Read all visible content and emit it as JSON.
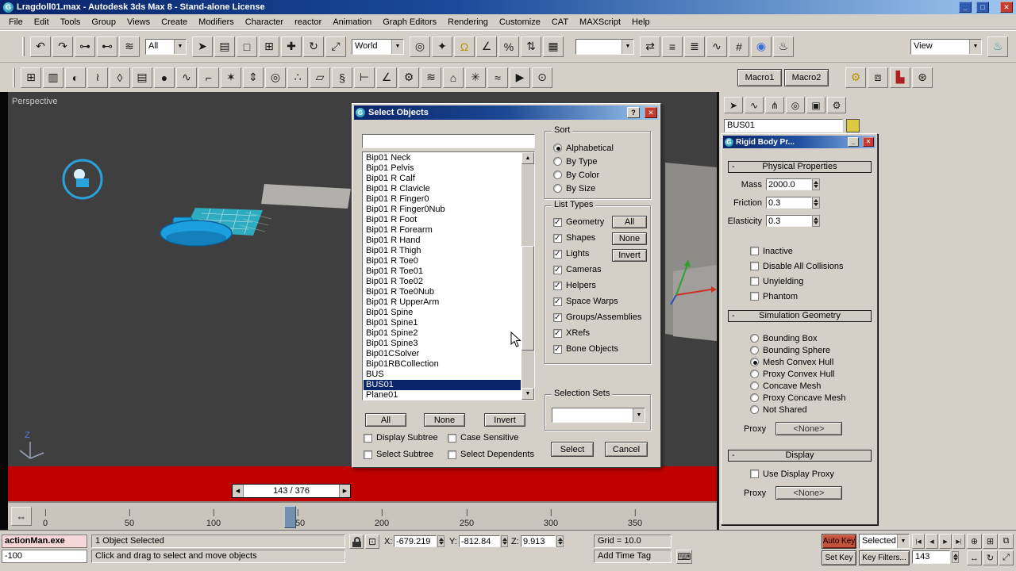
{
  "window": {
    "title": "Lragdoll01.max - Autodesk 3ds Max 8 - Stand-alone License",
    "icon_letter": "G",
    "min_glyph": "_",
    "max_glyph": "□",
    "close_glyph": "✕"
  },
  "menu": {
    "items": [
      "File",
      "Edit",
      "Tools",
      "Group",
      "Views",
      "Create",
      "Modifiers",
      "Character",
      "reactor",
      "Animation",
      "Graph Editors",
      "Rendering",
      "Customize",
      "CAT",
      "MAXScript",
      "Help"
    ]
  },
  "toolbar1": {
    "filter_dropdown": "All",
    "coord_dropdown": "World",
    "render_type_dropdown": "View",
    "group1": [
      {
        "name": "undo-icon",
        "glyph": "↶"
      },
      {
        "name": "redo-icon",
        "glyph": "↷"
      },
      {
        "name": "select-and-link-icon",
        "glyph": "⊶"
      },
      {
        "name": "unlink-selection-icon",
        "glyph": "⊷"
      },
      {
        "name": "bind-to-space-warp-icon",
        "glyph": "≋"
      }
    ],
    "group2": [
      {
        "name": "select-object-icon",
        "glyph": "➤"
      },
      {
        "name": "select-by-name-icon",
        "glyph": "▤"
      },
      {
        "name": "rectangular-selection-icon",
        "glyph": "□"
      },
      {
        "name": "window-crossing-icon",
        "glyph": "⊞"
      },
      {
        "name": "select-and-move-icon",
        "glyph": "✚"
      },
      {
        "name": "select-and-rotate-icon",
        "glyph": "↻"
      },
      {
        "name": "select-and-scale-icon",
        "glyph": "⤢"
      }
    ],
    "group3": [
      {
        "name": "use-pivot-center-icon",
        "glyph": "◎"
      },
      {
        "name": "select-and-manipulate-icon",
        "glyph": "✦"
      },
      {
        "name": "snap-toggle-icon",
        "glyph": "Ω",
        "cls": "yellow"
      },
      {
        "name": "angle-snap-icon",
        "glyph": "∠"
      },
      {
        "name": "percent-snap-icon",
        "glyph": "%"
      },
      {
        "name": "spinner-snap-icon",
        "glyph": "⇅"
      },
      {
        "name": "named-selection-sets-icon",
        "glyph": "▦"
      }
    ],
    "group4": [
      {
        "name": "mirror-icon",
        "glyph": "⇄"
      },
      {
        "name": "align-icon",
        "glyph": "≡"
      },
      {
        "name": "layer-manager-icon",
        "glyph": "≣"
      },
      {
        "name": "curve-editor-icon",
        "glyph": "∿"
      },
      {
        "name": "schematic-view-icon",
        "glyph": "#"
      },
      {
        "name": "material-editor-icon",
        "glyph": "◉",
        "cls": "mat"
      },
      {
        "name": "render-scene-icon",
        "glyph": "♨"
      }
    ],
    "group5": [
      {
        "name": "quick-render-icon",
        "glyph": "♨",
        "cls": "teal"
      }
    ]
  },
  "toolbar2": {
    "icons": [
      {
        "name": "rigid-body-collection-icon",
        "glyph": "⊞"
      },
      {
        "name": "cloth-collection-icon",
        "glyph": "▥"
      },
      {
        "name": "soft-body-collection-icon",
        "glyph": "◐"
      },
      {
        "name": "rope-collection-icon",
        "glyph": "≀"
      },
      {
        "name": "deforming-mesh-collection-icon",
        "glyph": "◊"
      },
      {
        "name": "cloth-modifier-icon",
        "glyph": "▤"
      },
      {
        "name": "soft-body-modifier-icon",
        "glyph": "●"
      },
      {
        "name": "rope-modifier-icon",
        "glyph": "∿"
      },
      {
        "name": "hinge-constraint-icon",
        "glyph": "⌐"
      },
      {
        "name": "ragdoll-constraint-icon",
        "glyph": "✶"
      },
      {
        "name": "prismatic-constraint-icon",
        "glyph": "⇕"
      },
      {
        "name": "car-wheel-constraint-icon",
        "glyph": "◎"
      },
      {
        "name": "point-point-constraint-icon",
        "glyph": "∴"
      },
      {
        "name": "plane-primitive-icon",
        "glyph": "▱"
      },
      {
        "name": "spring-icon",
        "glyph": "§"
      },
      {
        "name": "linear-dashpot-icon",
        "glyph": "⊢"
      },
      {
        "name": "angular-dashpot-icon",
        "glyph": "∠"
      },
      {
        "name": "motor-icon",
        "glyph": "⚙"
      },
      {
        "name": "wind-icon",
        "glyph": "≋"
      },
      {
        "name": "toy-car-icon",
        "glyph": "⌂"
      },
      {
        "name": "fracture-icon",
        "glyph": "✳"
      },
      {
        "name": "water-icon",
        "glyph": "≈"
      },
      {
        "name": "preview-animation-icon",
        "glyph": "▶"
      },
      {
        "name": "analyze-world-icon",
        "glyph": "⊙"
      }
    ],
    "macro1": "Macro1",
    "macro2": "Macro2",
    "icons_b": [
      {
        "name": "macro-gear-icon",
        "glyph": "⚙",
        "cls": "yellow"
      },
      {
        "name": "array-tool-icon",
        "glyph": "⧈"
      },
      {
        "name": "statistics-icon",
        "glyph": "▙",
        "cls": "red"
      },
      {
        "name": "particle-view-icon",
        "glyph": "⊛"
      }
    ]
  },
  "command_panel": {
    "tabs": [
      {
        "name": "create-tab-icon",
        "glyph": "➤"
      },
      {
        "name": "modify-tab-icon",
        "glyph": "∿"
      },
      {
        "name": "hierarchy-tab-icon",
        "glyph": "⋔"
      },
      {
        "name": "motion-tab-icon",
        "glyph": "◎"
      },
      {
        "name": "display-tab-icon",
        "glyph": "▣"
      },
      {
        "name": "utilities-tab-icon",
        "glyph": "⚙"
      }
    ],
    "object_name": "BUS01"
  },
  "viewport": {
    "label": "Perspective",
    "axis_label": "Z"
  },
  "dialog": {
    "title": "Select Objects",
    "help_glyph": "?",
    "items": [
      "Bip01 Neck",
      "Bip01 Pelvis",
      "Bip01 R Calf",
      "Bip01 R Clavicle",
      "Bip01 R Finger0",
      "Bip01 R Finger0Nub",
      "Bip01 R Foot",
      "Bip01 R Forearm",
      "Bip01 R Hand",
      "Bip01 R Thigh",
      "Bip01 R Toe0",
      "Bip01 R Toe01",
      "Bip01 R Toe02",
      "Bip01 R Toe0Nub",
      "Bip01 R UpperArm",
      "Bip01 Spine",
      "Bip01 Spine1",
      "Bip01 Spine2",
      "Bip01 Spine3",
      "Bip01CSolver",
      "Bip01RBCollection",
      "BUS",
      "BUS01",
      "Plane01"
    ],
    "selected": "BUS01",
    "sort_label": "Sort",
    "sort_options": [
      {
        "label": "Alphabetical",
        "state": "on"
      },
      {
        "label": "By Type",
        "state": "off"
      },
      {
        "label": "By Color",
        "state": "off"
      },
      {
        "label": "By Size",
        "state": "off"
      }
    ],
    "list_types_label": "List Types",
    "list_types": [
      {
        "label": "Geometry",
        "state": "on"
      },
      {
        "label": "Shapes",
        "state": "on"
      },
      {
        "label": "Lights",
        "state": "on"
      },
      {
        "label": "Cameras",
        "state": "on"
      },
      {
        "label": "Helpers",
        "state": "on"
      },
      {
        "label": "Space Warps",
        "state": "on"
      },
      {
        "label": "Groups/Assemblies",
        "state": "on"
      },
      {
        "label": "XRefs",
        "state": "on"
      },
      {
        "label": "Bone Objects",
        "state": "on"
      }
    ],
    "list_type_buttons": [
      "All",
      "None",
      "Invert"
    ],
    "selection_sets_label": "Selection Sets",
    "bottom_buttons": [
      "All",
      "None",
      "Invert"
    ],
    "checks": [
      {
        "label": "Display Subtree",
        "state": "off"
      },
      {
        "label": "Case Sensitive",
        "state": "off"
      },
      {
        "label": "Select Subtree",
        "state": "off"
      },
      {
        "label": "Select Dependents",
        "state": "off"
      }
    ],
    "select_label": "Select",
    "cancel_label": "Cancel"
  },
  "rigid_body": {
    "title": "Rigid Body Pr...",
    "rollout1": "Physical Properties",
    "fields": [
      {
        "label": "Mass",
        "value": "2000.0"
      },
      {
        "label": "Friction",
        "value": "0.3"
      },
      {
        "label": "Elasticity",
        "value": "0.3"
      }
    ],
    "checks": [
      {
        "label": "Inactive",
        "state": "off"
      },
      {
        "label": "Disable All Collisions",
        "state": "off"
      },
      {
        "label": "Unyielding",
        "state": "off"
      },
      {
        "label": "Phantom",
        "state": "off"
      }
    ],
    "rollout2": "Simulation Geometry",
    "geom_options": [
      {
        "label": "Bounding Box",
        "state": "off"
      },
      {
        "label": "Bounding Sphere",
        "state": "off"
      },
      {
        "label": "Mesh Convex Hull",
        "state": "on"
      },
      {
        "label": "Proxy Convex Hull",
        "state": "off"
      },
      {
        "label": "Concave Mesh",
        "state": "off"
      },
      {
        "label": "Proxy Concave Mesh",
        "state": "off"
      },
      {
        "label": "Not Shared",
        "state": "off"
      }
    ],
    "proxy_label": "Proxy",
    "proxy_value": "<None>",
    "rollout3": "Display",
    "display_check": "Use Display Proxy",
    "proxy2_label": "Proxy",
    "proxy2_value": "<None>"
  },
  "timeline": {
    "frame_indicator": "143 / 376",
    "ticks": [
      "0",
      "50",
      "100",
      "150",
      "200",
      "250",
      "300",
      "350"
    ]
  },
  "status": {
    "macro_recorder": "actionMan.exe",
    "listener": "-100",
    "selection": "1 Object Selected",
    "prompt": "Click and drag to select and move objects",
    "x_label": "X:",
    "x": "-679.219",
    "y_label": "Y:",
    "y": "-812.84",
    "z_label": "Z:",
    "z": "9.913",
    "grid": "Grid = 10.0",
    "add_time_tag": "Add Time Tag"
  },
  "anim": {
    "auto_key": "Auto Key",
    "set_key": "Set Key",
    "selected": "Selected",
    "key_filters": "Key Filters...",
    "frame": "143",
    "transport": [
      {
        "name": "go-to-start-button",
        "glyph": "|◀"
      },
      {
        "name": "previous-frame-button",
        "glyph": "◀"
      },
      {
        "name": "play-button",
        "glyph": "▶"
      },
      {
        "name": "go-to-end-button",
        "glyph": "▶|"
      }
    ],
    "nav_row1": [
      {
        "name": "zoom-icon",
        "glyph": "⊕"
      },
      {
        "name": "zoom-all-icon",
        "glyph": "⊞"
      },
      {
        "name": "zoom-extents-all-icon",
        "glyph": "⧉"
      }
    ],
    "nav_row2": [
      {
        "name": "pan-icon",
        "glyph": "↔"
      },
      {
        "name": "arc-rotate-icon",
        "glyph": "↻"
      },
      {
        "name": "min-max-toggle-icon",
        "glyph": "⤢"
      }
    ]
  },
  "ui": {
    "dropdown_arrow": "▼",
    "up_arrow": "▲",
    "down_arrow": "▼",
    "left_arrow": "◀",
    "right_arrow": "▶",
    "double_arrow": "⇔",
    "abs_glyph": "⊡",
    "kb_glyph": "⌨",
    "collapse_glyph": "-"
  }
}
